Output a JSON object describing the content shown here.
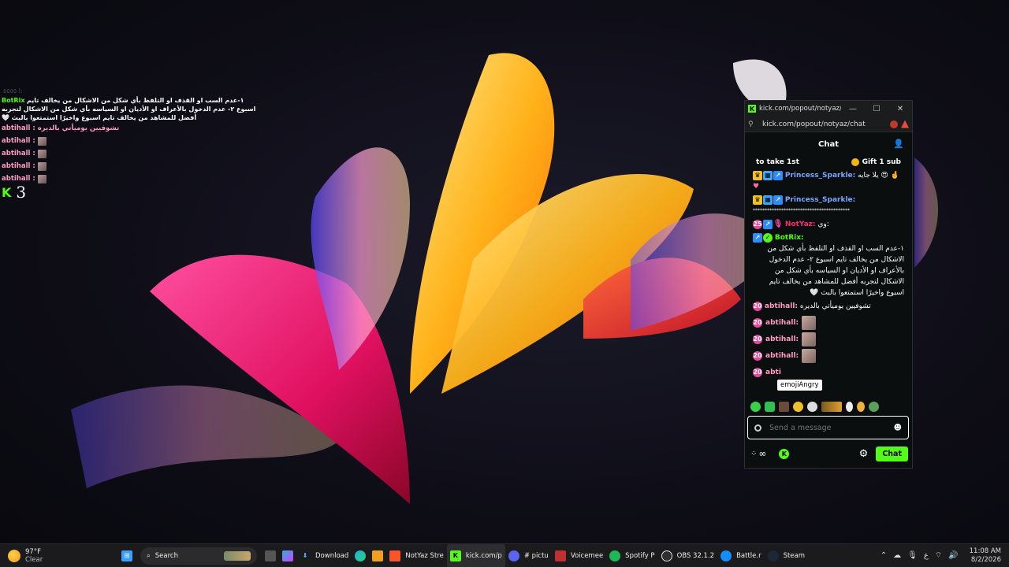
{
  "overlay": {
    "faint_line": "ا ٥٥٥٥:",
    "bot_name": "BotRix",
    "bot_message": "١-عدم السب او القذف او التلفظ بأي شكل من الاشكال من يخالف تايم اسبوع ٢- عدم الدخول بالأعراف او الأديان او السياسه بأي شكل من الاشكال لتجربه أفضل للمشاهد من يخالف تايم اسبوع واخيرًا استمتعوا بالبث 🤍",
    "user_msg": "abtihall : تشوفيين يوميأتي بالديره",
    "emote_users": [
      "abtihall :",
      "abtihall :",
      "abtihall :",
      "abtihall :"
    ],
    "kick_counter": "3"
  },
  "popout": {
    "window_title": "kick.com/popout/notyaz/ch...",
    "url": "kick.com/popout/notyaz/chat",
    "header_title": "Chat",
    "pinned_left": "to take 1st",
    "pinned_right": "Gift 1 sub",
    "messages": {
      "m1_name": "Princess_Sparkle:",
      "m1_text": "يلا جايه 😍 🤞",
      "m2_name": "Princess_Sparkle:",
      "m2_text": "*****************************************",
      "m3_name": "NotYaz:",
      "m3_text": "وي:",
      "m4_name": "BotRix:",
      "m4_text": "١-عدم السب او القذف او التلفظ بأي شكل من الاشكال من يخالف تايم اسبوع ٢- عدم الدخول بالأعراف او الأديان او السياسه بأي شكل من الاشكال لتجربه أفضل للمشاهد من يخالف تايم اسبوع واخيرًا استمتعوا بالبث 🤍",
      "m5_name": "abtihall:",
      "m5_text": "تشوفيين يوميأتي بالديره",
      "m6_name": "abtihall:",
      "m7_name": "abtihall:",
      "m8_name": "abtihall:",
      "m9_name": "abti"
    },
    "tooltip": "emojiAngry",
    "input_placeholder": "Send a message",
    "chat_button": "Chat"
  },
  "taskbar": {
    "temperature": "97°F",
    "condition": "Clear",
    "search_label": "Search",
    "items": [
      {
        "label": "Download"
      },
      {
        "label": "NotYaz Stre"
      },
      {
        "label": "kick.com/p"
      },
      {
        "label": "# pictu"
      },
      {
        "label": "Voicemee"
      },
      {
        "label": "Spotify P"
      },
      {
        "label": "OBS 32.1.2"
      },
      {
        "label": "Battle.r"
      },
      {
        "label": "Steam"
      }
    ],
    "time": "11:08 AM",
    "date": "8/2/2026",
    "lang": "ع"
  }
}
